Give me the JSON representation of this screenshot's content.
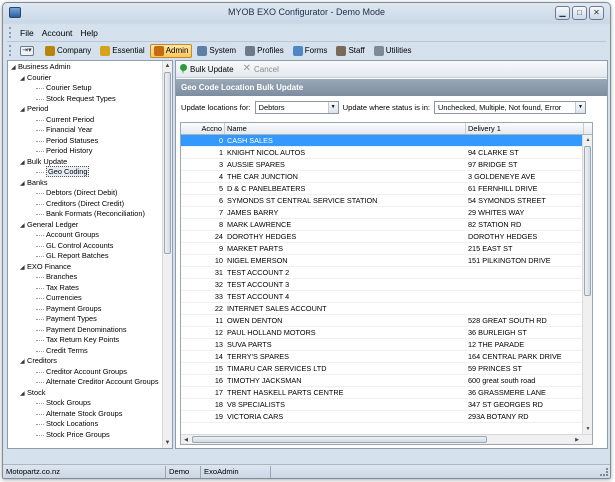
{
  "window": {
    "title": "MYOB EXO Configurator - Demo Mode"
  },
  "menu": [
    "File",
    "Account",
    "Help"
  ],
  "toolbar": [
    {
      "label": "Company",
      "icon": "house-icon",
      "color": "#b8860b",
      "active": false
    },
    {
      "label": "Essential",
      "icon": "wand-icon",
      "color": "#d9a21b",
      "active": false
    },
    {
      "label": "Admin",
      "icon": "admin-icon",
      "color": "#c56b12",
      "active": true
    },
    {
      "label": "System",
      "icon": "system-icon",
      "color": "#5f7fa8",
      "active": false
    },
    {
      "label": "Profiles",
      "icon": "profiles-icon",
      "color": "#6e7a8a",
      "active": false
    },
    {
      "label": "Forms",
      "icon": "forms-icon",
      "color": "#4f86c6",
      "active": false
    },
    {
      "label": "Staff",
      "icon": "staff-icon",
      "color": "#7a6a5a",
      "active": false
    },
    {
      "label": "Utilities",
      "icon": "utilities-icon",
      "color": "#7d8b99",
      "active": false
    }
  ],
  "tree": [
    {
      "level": 0,
      "label": "Business Admin",
      "expanded": true
    },
    {
      "level": 1,
      "label": "Courier",
      "expanded": true
    },
    {
      "level": 2,
      "label": "Courier Setup"
    },
    {
      "level": 2,
      "label": "Stock Request Types"
    },
    {
      "level": 1,
      "label": "Period",
      "expanded": true
    },
    {
      "level": 2,
      "label": "Current Period"
    },
    {
      "level": 2,
      "label": "Financial Year"
    },
    {
      "level": 2,
      "label": "Period Statuses"
    },
    {
      "level": 2,
      "label": "Period History"
    },
    {
      "level": 1,
      "label": "Bulk Update",
      "expanded": true
    },
    {
      "level": 2,
      "label": "Geo Coding",
      "selected": true
    },
    {
      "level": 1,
      "label": "Banks",
      "expanded": true
    },
    {
      "level": 2,
      "label": "Debtors (Direct Debit)"
    },
    {
      "level": 2,
      "label": "Creditors (Direct Credit)"
    },
    {
      "level": 2,
      "label": "Bank Formats (Reconciliation)"
    },
    {
      "level": 1,
      "label": "General Ledger",
      "expanded": true
    },
    {
      "level": 2,
      "label": "Account Groups"
    },
    {
      "level": 2,
      "label": "GL Control Accounts"
    },
    {
      "level": 2,
      "label": "GL Report Batches"
    },
    {
      "level": 1,
      "label": "EXO Finance",
      "expanded": true
    },
    {
      "level": 2,
      "label": "Branches"
    },
    {
      "level": 2,
      "label": "Tax Rates"
    },
    {
      "level": 2,
      "label": "Currencies"
    },
    {
      "level": 2,
      "label": "Payment Groups"
    },
    {
      "level": 2,
      "label": "Payment Types"
    },
    {
      "level": 2,
      "label": "Payment Denominations"
    },
    {
      "level": 2,
      "label": "Tax Return Key Points"
    },
    {
      "level": 2,
      "label": "Credit Terms"
    },
    {
      "level": 1,
      "label": "Creditors",
      "expanded": true
    },
    {
      "level": 2,
      "label": "Creditor Account Groups"
    },
    {
      "level": 2,
      "label": "Alternate Creditor Account Groups"
    },
    {
      "level": 1,
      "label": "Stock",
      "expanded": true
    },
    {
      "level": 2,
      "label": "Stock Groups"
    },
    {
      "level": 2,
      "label": "Alternate Stock Groups"
    },
    {
      "level": 2,
      "label": "Stock Locations"
    },
    {
      "level": 2,
      "label": "Stock Price Groups"
    }
  ],
  "subtoolbar": {
    "bulk_update": "Bulk Update",
    "cancel": "Cancel"
  },
  "panel": {
    "header": "Geo Code Location Bulk Update",
    "update_for_label": "Update locations for:",
    "update_for_value": "Debtors",
    "status_label": "Update where status is in:",
    "status_value": "Unchecked, Multiple, Not found, Error"
  },
  "grid": {
    "columns": [
      "Accno",
      "Name",
      "Delivery 1"
    ],
    "rows": [
      [
        "0",
        "CASH SALES",
        ""
      ],
      [
        "1",
        "KNIGHT NICOL AUTOS",
        "94 CLARKE ST"
      ],
      [
        "3",
        "AUSSIE SPARES",
        "97 BRIDGE ST"
      ],
      [
        "4",
        "THE CAR JUNCTION",
        "3 GOLDENEYE AVE"
      ],
      [
        "5",
        "D & C PANELBEATERS",
        "61 FERNHILL DRIVE"
      ],
      [
        "6",
        "SYMONDS ST CENTRAL SERVICE STATION",
        "54 SYMONDS STREET"
      ],
      [
        "7",
        "JAMES BARRY",
        "29 WHITES WAY"
      ],
      [
        "8",
        "MARK LAWRENCE",
        "82 STATION RD"
      ],
      [
        "24",
        "DOROTHY HEDGES",
        "DOROTHY HEDGES"
      ],
      [
        "9",
        "MARKET PARTS",
        "215 EAST ST"
      ],
      [
        "10",
        "NIGEL EMERSON",
        "151 PILKINGTON DRIVE"
      ],
      [
        "31",
        "TEST ACCOUNT 2",
        ""
      ],
      [
        "32",
        "TEST ACCOUNT 3",
        ""
      ],
      [
        "33",
        "TEST ACCOUNT 4",
        ""
      ],
      [
        "22",
        "INTERNET SALES ACCOUNT",
        ""
      ],
      [
        "11",
        "OWEN DENTON",
        "528 GREAT SOUTH RD"
      ],
      [
        "12",
        "PAUL HOLLAND MOTORS",
        "36 BURLEIGH ST"
      ],
      [
        "13",
        "SUVA PARTS",
        "12 THE PARADE"
      ],
      [
        "14",
        "TERRY'S SPARES",
        "164 CENTRAL PARK DRIVE"
      ],
      [
        "15",
        "TIMARU CAR SERVICES LTD",
        "59 PRINCES ST"
      ],
      [
        "16",
        "TIMOTHY JACKSMAN",
        "600 great south road"
      ],
      [
        "17",
        "TRENT HASKELL PARTS CENTRE",
        "36 GRASSMERE LANE"
      ],
      [
        "18",
        "V8 SPECIALISTS",
        "347 ST GEORGES RD"
      ],
      [
        "19",
        "VICTORIA CARS",
        "293A BOTANY RD"
      ]
    ],
    "selected_row": 0
  },
  "status": [
    "Motopartz.co.nz",
    "Demo",
    "ExoAdmin"
  ]
}
